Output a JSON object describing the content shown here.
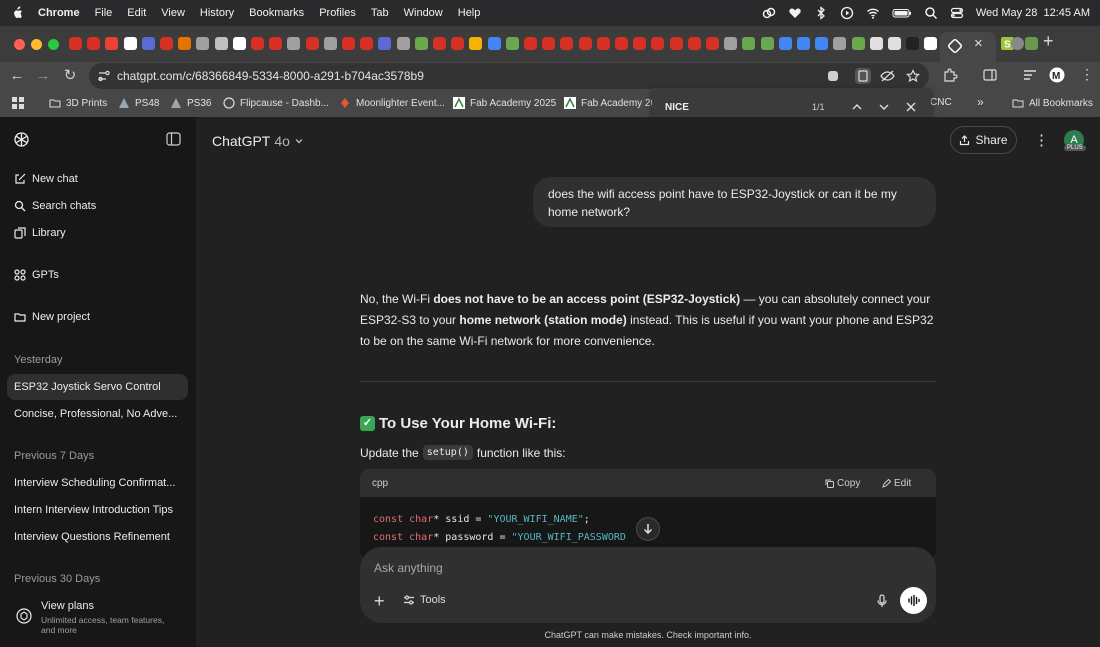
{
  "menubar": {
    "items": [
      "Chrome",
      "File",
      "Edit",
      "View",
      "History",
      "Bookmarks",
      "Profiles",
      "Tab",
      "Window",
      "Help"
    ],
    "datetime": "Wed May 28  12:45 AM"
  },
  "browser": {
    "url": "chatgpt.com/c/68366849-5334-8000-a291-b704ac3578b9",
    "bookmarks": [
      {
        "label": "3D Prints",
        "icon": "folder-icon"
      },
      {
        "label": "PS48",
        "icon": "triangle-icon"
      },
      {
        "label": "PS36",
        "icon": "triangle-icon"
      },
      {
        "label": "Flipcause - Dashb...",
        "icon": "flipcause-icon"
      },
      {
        "label": "Moonlighter Event...",
        "icon": "moonlighter-icon"
      },
      {
        "label": "Fab Academy 2025",
        "icon": "fab-icon"
      },
      {
        "label": "Fab Academy 20",
        "icon": "fab-icon"
      },
      {
        "label": "CNC",
        "icon": ""
      }
    ],
    "all_bookmarks": "All Bookmarks"
  },
  "findbar": {
    "query": "NICE",
    "count": "1/1"
  },
  "sidebar": {
    "primary": [
      {
        "label": "New chat",
        "icon": "compose-icon"
      },
      {
        "label": "Search chats",
        "icon": "search-icon"
      },
      {
        "label": "Library",
        "icon": "library-icon"
      },
      {
        "label": "GPTs",
        "icon": "gpts-icon"
      },
      {
        "label": "New project",
        "icon": "folder-plus-icon"
      }
    ],
    "sections": [
      {
        "heading": "Yesterday",
        "chats": [
          "ESP32 Joystick Servo Control",
          "Concise, Professional, No Adve..."
        ]
      },
      {
        "heading": "Previous 7 Days",
        "chats": [
          "Interview Scheduling Confirmat...",
          "Intern Interview Introduction Tips",
          "Interview Questions Refinement"
        ]
      },
      {
        "heading": "Previous 30 Days",
        "chats": []
      }
    ],
    "plans": {
      "title": "View plans",
      "subtitle_line1": "Unlimited access, team features,",
      "subtitle_line2": "and more"
    }
  },
  "header": {
    "model": "ChatGPT",
    "version": "4o",
    "share": "Share",
    "avatar_letter": "A",
    "badge": "PLUS"
  },
  "conversation": {
    "user_message": "does the wifi access point have to ESP32-Joystick or can it be my home network?",
    "answer": {
      "p1_a": "No, the Wi-Fi ",
      "p1_b": "does not have to be an access point (ESP32-Joystick)",
      "p1_c": " — you can absolutely connect your ESP32-S3 to your ",
      "p1_d": "home network (station mode)",
      "p1_e": " instead. This is useful if you want your phone and ESP32 to be on the same Wi-Fi network for more convenience."
    },
    "heading": "To Use Your Home Wi-Fi:",
    "update_prefix": "Update the",
    "update_code": "setup()",
    "update_suffix": "function like this:",
    "code": {
      "lang": "cpp",
      "copy": "Copy",
      "edit": "Edit",
      "line1": {
        "kw1": "const",
        "kw2": "char",
        "rest": "* ssid = ",
        "str": "\"YOUR_WIFI_NAME\"",
        "end": ";"
      },
      "line2": {
        "kw1": "const",
        "kw2": "char",
        "rest": "* password = ",
        "str": "\"YOUR_WIFI_PASSWORD",
        "end": ""
      }
    }
  },
  "composer": {
    "placeholder": "Ask anything",
    "tools": "Tools"
  },
  "disclaimer": "ChatGPT can make mistakes. Check important info."
}
